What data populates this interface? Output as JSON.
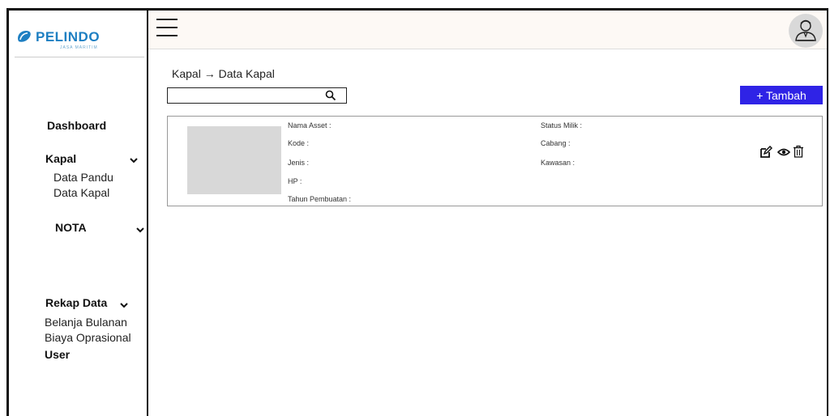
{
  "brand": {
    "name": "PELINDO",
    "tagline": "JASA MARITIM",
    "color": "#1e7fc2"
  },
  "sidebar": {
    "dashboard": "Dashboard",
    "kapal": {
      "label": "Kapal",
      "items": [
        "Data Pandu",
        "Data Kapal"
      ]
    },
    "nota": {
      "label": "NOTA"
    },
    "rekap": {
      "label": "Rekap Data",
      "items": [
        "Belanja Bulanan",
        "Biaya Oprasional"
      ]
    },
    "user": "User"
  },
  "header": {
    "menu_icon": "hamburger-icon",
    "avatar_icon": "user-avatar-icon"
  },
  "breadcrumb": "Kapal → Data Kapal",
  "search": {
    "value": "",
    "placeholder": ""
  },
  "add_button": {
    "label": "+  Tambah",
    "color": "#2f23e6"
  },
  "card": {
    "left_fields": [
      "Nama Asset :",
      "Kode :",
      "Jenis :",
      "HP  :",
      "Tahun Pembuatan :"
    ],
    "right_fields": [
      "Status Milik :",
      "Cabang :",
      "Kawasan :"
    ],
    "actions": [
      "edit-icon",
      "view-icon",
      "delete-icon"
    ]
  }
}
